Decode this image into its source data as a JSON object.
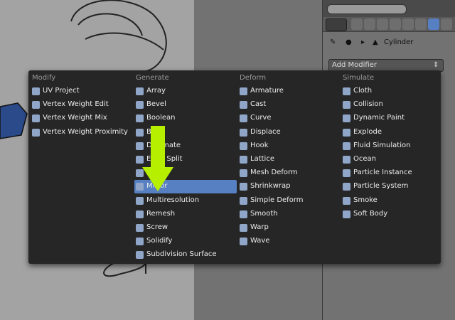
{
  "properties": {
    "object_name": "Cylinder",
    "add_modifier_label": "Add Modifier",
    "add_modifier_chevron": "⇕"
  },
  "menu": {
    "columns": [
      {
        "title": "Modify",
        "items": [
          "UV Project",
          "Vertex Weight Edit",
          "Vertex Weight Mix",
          "Vertex Weight Proximity"
        ]
      },
      {
        "title": "Generate",
        "items": [
          "Array",
          "Bevel",
          "Boolean",
          "Build",
          "Decimate",
          "Edge Split",
          "Mask",
          "Mirror",
          "Multiresolution",
          "Remesh",
          "Screw",
          "Solidify",
          "Subdivision Surface"
        ]
      },
      {
        "title": "Deform",
        "items": [
          "Armature",
          "Cast",
          "Curve",
          "Displace",
          "Hook",
          "Lattice",
          "Mesh Deform",
          "Shrinkwrap",
          "Simple Deform",
          "Smooth",
          "Warp",
          "Wave"
        ]
      },
      {
        "title": "Simulate",
        "items": [
          "Cloth",
          "Collision",
          "Dynamic Paint",
          "Explode",
          "Fluid Simulation",
          "Ocean",
          "Particle Instance",
          "Particle System",
          "Smoke",
          "Soft Body"
        ]
      }
    ],
    "highlighted": "Mirror"
  },
  "colors": {
    "accent": "#5680c2",
    "arrow": "#b6f000",
    "menu_bg": "#262626"
  }
}
